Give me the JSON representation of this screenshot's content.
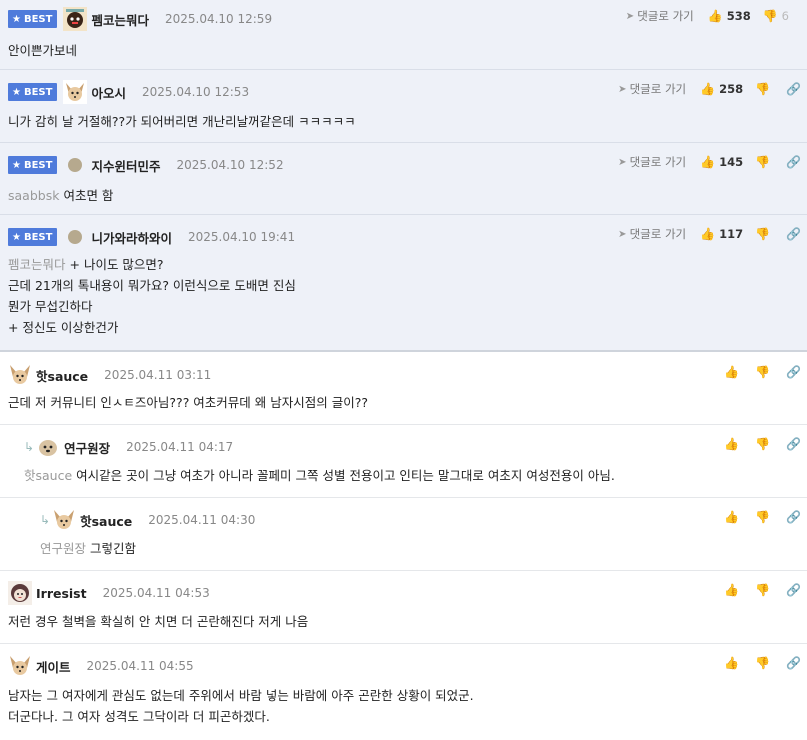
{
  "best_badge": "BEST",
  "reply_link": "댓글로 가기",
  "comments": [
    {
      "nick": "펨코는뭐다",
      "date": "2025.04.10 12:59",
      "up": "538",
      "down": "6",
      "lines": [
        "안이쁜가보네"
      ]
    },
    {
      "nick": "아오시",
      "date": "2025.04.10 12:53",
      "up": "258",
      "lines": [
        "니가 감히 날 거절해??가 되어버리면 개난리날꺼같은데 ㅋㅋㅋㅋㅋ"
      ]
    },
    {
      "nick": "지수윈터민주",
      "date": "2025.04.10 12:52",
      "up": "145",
      "mention": "saabbsk",
      "lines": [
        "여초면 함"
      ]
    },
    {
      "nick": "니가와라하와이",
      "date": "2025.04.10 19:41",
      "up": "117",
      "mention": "펨코는뭐다",
      "lines": [
        "+ 나이도 많으면?",
        "근데 21개의 톡내용이 뭐가요? 이런식으로 도배면 진심",
        "뭔가 무섭긴하다",
        "+ 정신도 이상한건가"
      ]
    },
    {
      "nick": "핫sauce",
      "date": "2025.04.11 03:11",
      "lines": [
        "근데 저 커뮤니티 인ㅅㅌ즈아님??? 여초커뮤데 왜 남자시점의 글이??"
      ]
    },
    {
      "nick": "연구원장",
      "date": "2025.04.11 04:17",
      "mention": "핫sauce",
      "lines": [
        "여시같은 곳이 그냥 여초가 아니라 꼴페미 그쪽 성별 전용이고 인티는 말그대로 여초지 여성전용이 아님."
      ]
    },
    {
      "nick": "핫sauce",
      "date": "2025.04.11 04:30",
      "mention": "연구원장",
      "lines": [
        "그렇긴함"
      ]
    },
    {
      "nick": "Irresist",
      "date": "2025.04.11 04:53",
      "lines": [
        "저런 경우 철벽을 확실히 안 치면 더 곤란해진다 저게 나음"
      ]
    },
    {
      "nick": "게이트",
      "date": "2025.04.11 04:55",
      "lines": [
        "남자는 그 여자에게 관심도 없는데 주위에서 바람 넣는 바람에 아주 곤란한 상황이 되었군.",
        "더군다나. 그 여자 성격도 그닥이라 더 피곤하겠다."
      ]
    }
  ]
}
